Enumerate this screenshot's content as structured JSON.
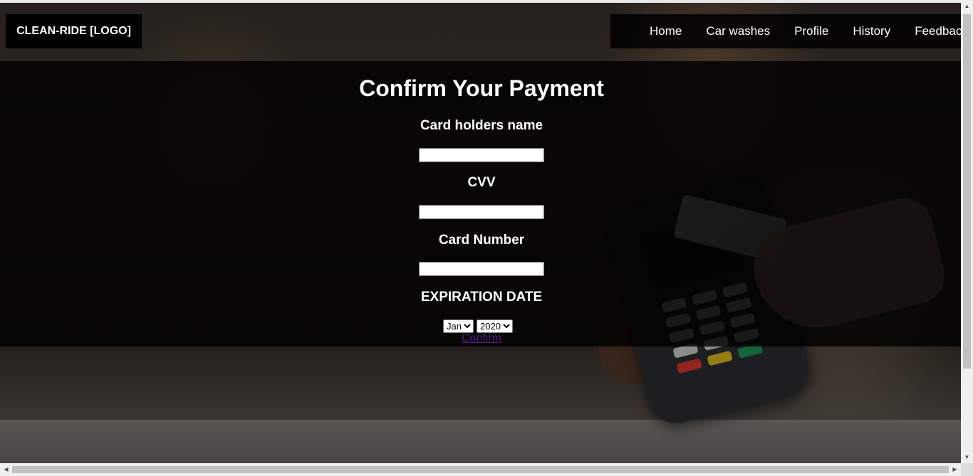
{
  "header": {
    "logo": "CLEAN-RIDE [LOGO]",
    "nav": [
      {
        "label": "Home"
      },
      {
        "label": "Car washes"
      },
      {
        "label": "Profile"
      },
      {
        "label": "History"
      },
      {
        "label": "Feedback"
      }
    ]
  },
  "form": {
    "title": "Confirm Your Payment",
    "name_label": "Card holders name",
    "name_value": "",
    "cvv_label": "CVV",
    "cvv_value": "",
    "number_label": "Card Number",
    "number_value": "",
    "expiry_label": "EXPIRATION DATE",
    "month_selected": "Jan",
    "year_selected": "2020",
    "confirm_label": "Confirm"
  },
  "colors": {
    "nav_bg": "#000000",
    "panel_bg": "#000000",
    "link_visited": "#551a8b"
  },
  "icons": {
    "scroll_up": "arrow-up-icon",
    "scroll_down": "arrow-down-icon",
    "scroll_left": "arrow-left-icon",
    "scroll_right": "arrow-right-icon"
  }
}
